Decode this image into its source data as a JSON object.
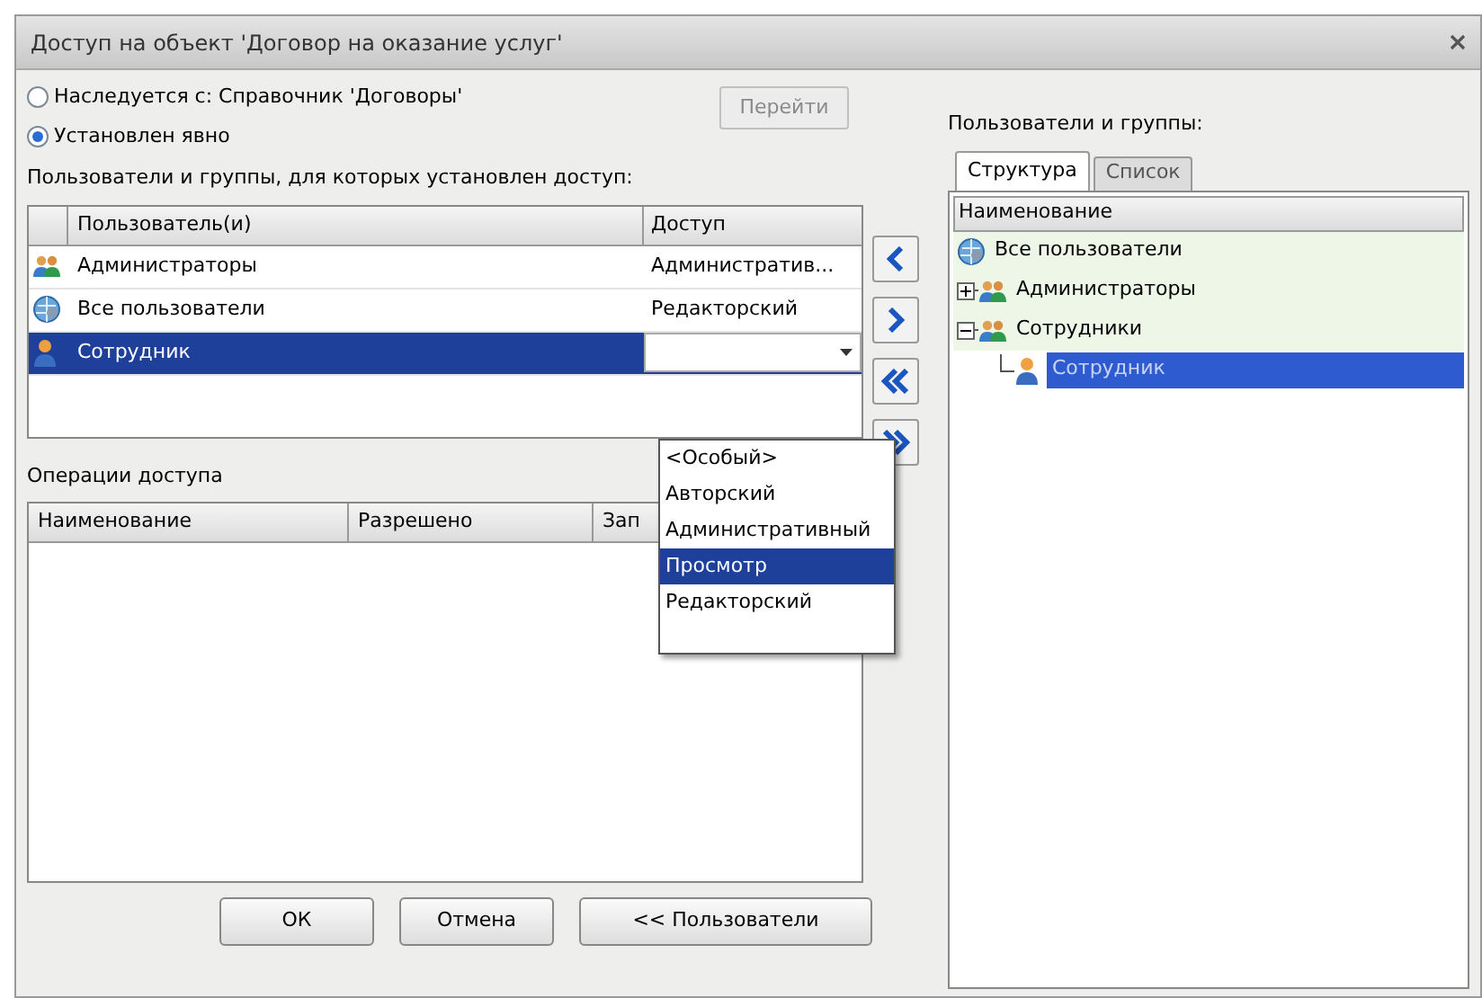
{
  "window": {
    "title": "Доступ на объект 'Договор на оказание услуг'"
  },
  "inheritance": {
    "options": [
      {
        "label": "Наследуется с: Справочник 'Договоры'",
        "selected": false
      },
      {
        "label": "Установлен явно",
        "selected": true
      }
    ],
    "goto_button": {
      "label": "Перейти",
      "disabled": true
    }
  },
  "access_table": {
    "label": "Пользователи и группы, для которых установлен доступ:",
    "columns": [
      "Пользователь(и)",
      "Доступ"
    ],
    "rows": [
      {
        "kind": "group",
        "name": "Администраторы",
        "access": "Административ...",
        "selected": false
      },
      {
        "kind": "all",
        "name": "Все пользователи",
        "access": "Редакторский",
        "selected": false
      },
      {
        "kind": "user",
        "name": "Сотрудник",
        "selected": true
      }
    ]
  },
  "access_dropdown": {
    "options": [
      {
        "label": "<Особый>",
        "selected": false
      },
      {
        "label": "Авторский",
        "selected": false
      },
      {
        "label": "Административный",
        "selected": false
      },
      {
        "label": "Просмотр",
        "selected": true
      },
      {
        "label": "Редакторский",
        "selected": false
      }
    ]
  },
  "operations": {
    "label": "Операции доступа",
    "columns": [
      "Наименование",
      "Разрешено",
      "Зап"
    ]
  },
  "buttons": [
    "ОК",
    "Отмена",
    "<< Пользователи"
  ],
  "users_panel": {
    "label": "Пользователи и группы:",
    "tabs": [
      {
        "label": "Структура",
        "selected": true
      },
      {
        "label": "Список",
        "selected": false
      }
    ],
    "column": "Наименование",
    "tree": [
      {
        "kind": "all",
        "label": "Все пользователи",
        "selected": false
      },
      {
        "kind": "group",
        "label": "Администраторы",
        "selected": false,
        "expanded": false
      },
      {
        "kind": "group",
        "label": "Сотрудники",
        "selected": false,
        "expanded": true,
        "children": [
          {
            "kind": "user",
            "label": "Сотрудник",
            "selected": true
          }
        ]
      }
    ]
  }
}
